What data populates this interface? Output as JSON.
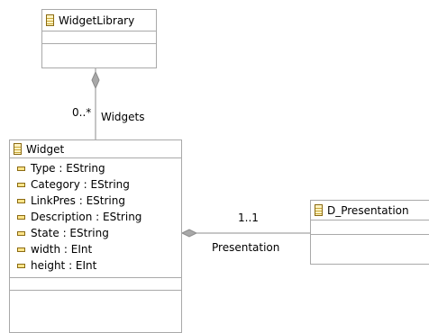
{
  "classes": {
    "widget_library": {
      "name": "WidgetLibrary"
    },
    "widget": {
      "name": "Widget",
      "attributes": [
        "Type : EString",
        "Category : EString",
        "LinkPres : EString",
        "Description : EString",
        "State : EString",
        "width : EInt",
        "height : EInt"
      ]
    },
    "d_presentation": {
      "name": "D_Presentation"
    }
  },
  "associations": {
    "widgets": {
      "multiplicity": "0..*",
      "role": "Widgets"
    },
    "presentation": {
      "multiplicity": "1..1",
      "role": "Presentation"
    }
  },
  "colors": {
    "class_border": "#a9a9a9",
    "edge": "#8c8c8c",
    "class_icon_fill": "#fff3c2",
    "attr_icon_fill": "#ffe58a"
  }
}
